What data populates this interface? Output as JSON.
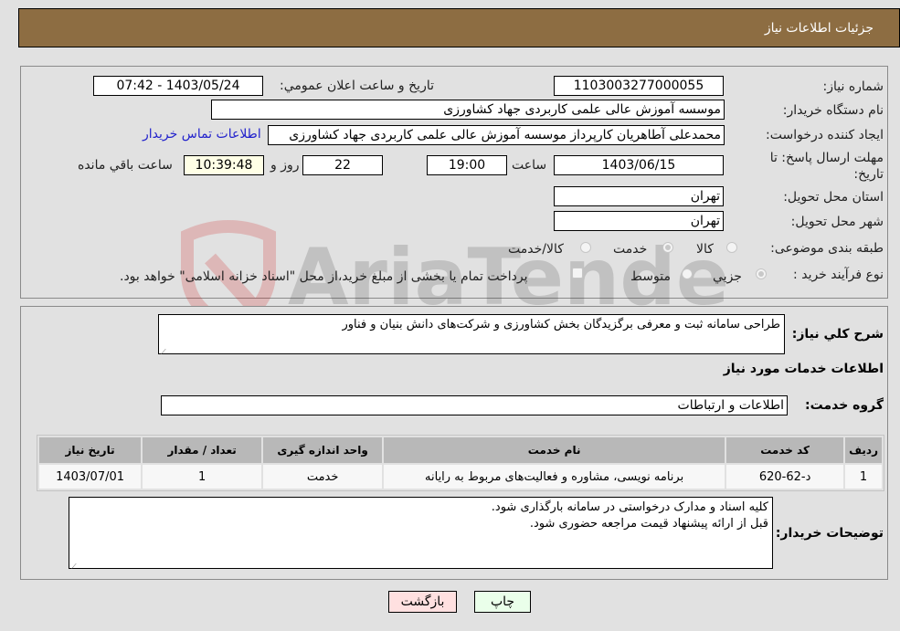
{
  "header": {
    "title": "جزئیات اطلاعات نیاز"
  },
  "form": {
    "need_number": {
      "label": "شماره نیاز:",
      "value": "1103003277000055"
    },
    "announce": {
      "label": "تاریخ و ساعت اعلان عمومي:",
      "value": "1403/05/24 - 07:42"
    },
    "buyer_org": {
      "label": "نام دستگاه خریدار:",
      "value": "موسسه آموزش عالی علمی کاربردی جهاد کشاورزی"
    },
    "requester": {
      "label": "ایجاد کننده درخواست:",
      "value": "محمدعلی آطاهریان کارپرداز موسسه آموزش عالی علمی کاربردی جهاد کشاورزی",
      "contact_link": "اطلاعات تماس خریدار"
    },
    "deadline": {
      "label": "مهلت ارسال پاسخ: تا تاریخ:",
      "date": "1403/06/15",
      "time_label": "ساعت",
      "time": "19:00",
      "days": "22",
      "days_label": "روز و",
      "remaining": "10:39:48",
      "remaining_label": "ساعت باقي مانده"
    },
    "province": {
      "label": "استان محل تحویل:",
      "value": "تهران"
    },
    "city": {
      "label": "شهر محل تحویل:",
      "value": "تهران"
    },
    "category": {
      "label": "طبقه بندی موضوعی:",
      "options": [
        "کالا",
        "خدمت",
        "کالا/خدمت"
      ],
      "selected": "خدمت"
    },
    "process": {
      "label": "نوع فرآیند خرید :",
      "options": [
        "جزيي",
        "متوسط"
      ],
      "selected": "جزيي",
      "treasury_note": "پرداخت تمام یا بخشی از مبلغ خرید،از محل \"اسناد خزانه اسلامی\" خواهد بود."
    }
  },
  "details": {
    "summary_label": "شرح كلي نياز:",
    "summary_value": "طراحی سامانه ثبت و معرفی برگزیدگان بخش کشاورزی و شرکت‌های دانش بنیان و فناور",
    "services_title": "اطلاعات خدمات مورد نیاز",
    "service_group_label": "گروه خدمت:",
    "service_group_value": "اطلاعات و ارتباطات",
    "table": {
      "headers": [
        "ردیف",
        "کد خدمت",
        "نام خدمت",
        "واحد اندازه گیری",
        "تعداد / مقدار",
        "تاریخ نیاز"
      ],
      "rows": [
        [
          "1",
          "د-62-620",
          "برنامه نویسی، مشاوره و فعالیت‌های مربوط به رایانه",
          "خدمت",
          "1",
          "1403/07/01"
        ]
      ]
    },
    "buyer_notes_label": "توضیحات خریدار:",
    "buyer_notes_lines": [
      "کلیه اسناد و مدارک درخواستی در سامانه بارگذاری شود.",
      "قبل از ارائه پیشنهاد قیمت مراجعه حضوری شود."
    ]
  },
  "buttons": {
    "print": "چاپ",
    "back": "بازگشت"
  },
  "watermark": {
    "text": "AriaTender.neT"
  },
  "colors": {
    "header_bg": "#8d6d42",
    "print_bg": "#eaffea",
    "back_bg": "#ffe0e0",
    "remaining_bg": "#ffffe6"
  }
}
